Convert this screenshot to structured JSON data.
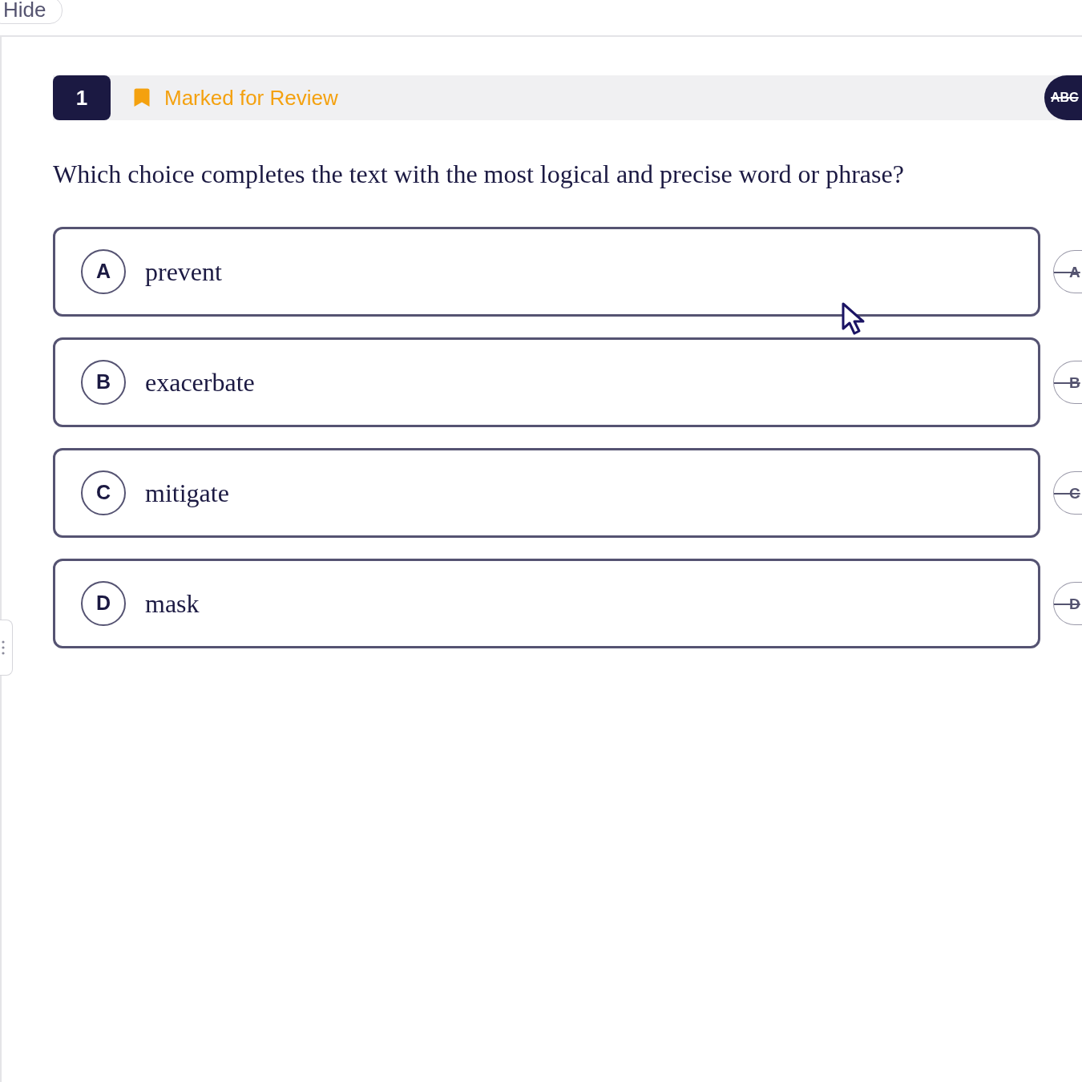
{
  "top_bar": {
    "hide_button": "Hide"
  },
  "question": {
    "number": "1",
    "marked_for_review": true,
    "review_label": "Marked for Review",
    "cross_out_label": "ABC",
    "cross_out_mode": true,
    "prompt": "Which choice completes the text with the most logical and precise word or phrase?"
  },
  "choices": [
    {
      "letter": "A",
      "text": "prevent",
      "selected": false,
      "strike_letter": "A"
    },
    {
      "letter": "B",
      "text": "exacerbate",
      "selected": false,
      "strike_letter": "B"
    },
    {
      "letter": "C",
      "text": "mitigate",
      "selected": false,
      "strike_letter": "C"
    },
    {
      "letter": "D",
      "text": "mask",
      "selected": false,
      "strike_letter": "D"
    }
  ]
}
